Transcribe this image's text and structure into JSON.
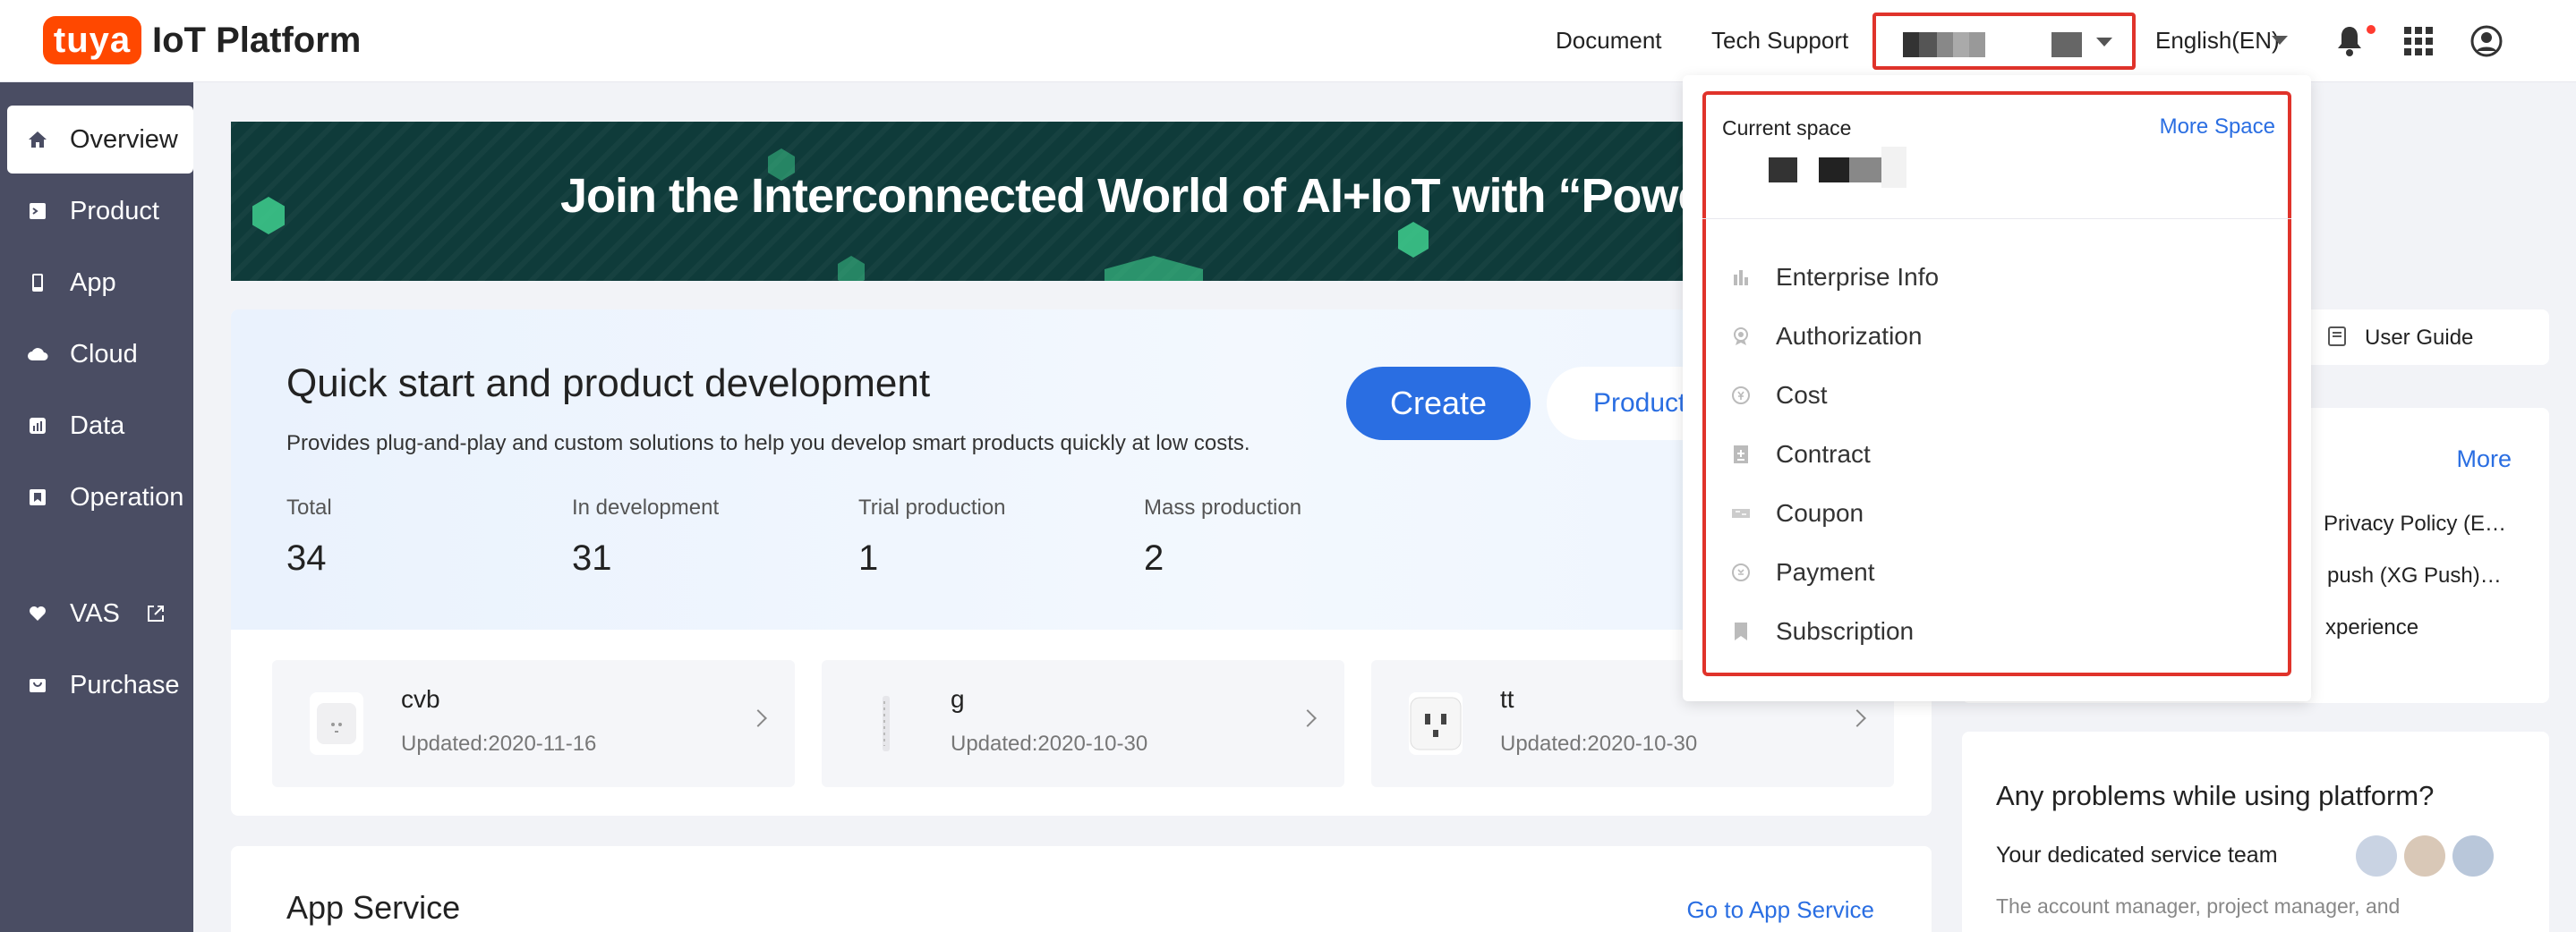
{
  "header": {
    "logo_badge": "tuya",
    "logo_text": "IoT Platform",
    "document": "Document",
    "tech_support": "Tech Support",
    "language": "English(EN)"
  },
  "sidebar": {
    "items": [
      {
        "label": "Overview"
      },
      {
        "label": "Product"
      },
      {
        "label": "App"
      },
      {
        "label": "Cloud"
      },
      {
        "label": "Data"
      },
      {
        "label": "Operation"
      },
      {
        "label": "VAS"
      },
      {
        "label": "Purchase"
      }
    ]
  },
  "banner": {
    "title": "Join the Interconnected World of AI+IoT with “Powered B"
  },
  "quick_start": {
    "title": "Quick start and product development",
    "subtitle": "Provides plug-and-play and custom solutions to help you develop smart products quickly at low costs.",
    "create": "Create",
    "product": "Product",
    "stats": [
      {
        "label": "Total",
        "value": "34"
      },
      {
        "label": "In development",
        "value": "31"
      },
      {
        "label": "Trial production",
        "value": "1"
      },
      {
        "label": "Mass production",
        "value": "2"
      }
    ],
    "products": [
      {
        "name": "cvb",
        "updated": "Updated:2020-11-16"
      },
      {
        "name": "g",
        "updated": "Updated:2020-10-30"
      },
      {
        "name": "tt",
        "updated": "Updated:2020-10-30"
      }
    ]
  },
  "app_service": {
    "title": "App Service",
    "link": "Go to App Service"
  },
  "right": {
    "user_guide": "User Guide",
    "more": "More",
    "news": [
      "Privacy Policy (E…",
      "push (XG Push)…",
      "xperience"
    ],
    "problems_title": "Any problems while using platform?",
    "team_label": "Your dedicated service team",
    "team_desc": "The account manager, project manager, and"
  },
  "dropdown": {
    "current_space_label": "Current space",
    "more_space": "More Space",
    "items": [
      {
        "label": "Enterprise Info",
        "icon": "enterprise-icon"
      },
      {
        "label": "Authorization",
        "icon": "authorization-icon"
      },
      {
        "label": "Cost",
        "icon": "cost-icon"
      },
      {
        "label": "Contract",
        "icon": "contract-icon"
      },
      {
        "label": "Coupon",
        "icon": "coupon-icon"
      },
      {
        "label": "Payment",
        "icon": "payment-icon"
      },
      {
        "label": "Subscription",
        "icon": "subscription-icon"
      }
    ]
  },
  "colors": {
    "accent": "#2a6ee2",
    "highlight": "#e0332b",
    "brand": "#ff4800",
    "sidebar": "#4a4d63"
  }
}
